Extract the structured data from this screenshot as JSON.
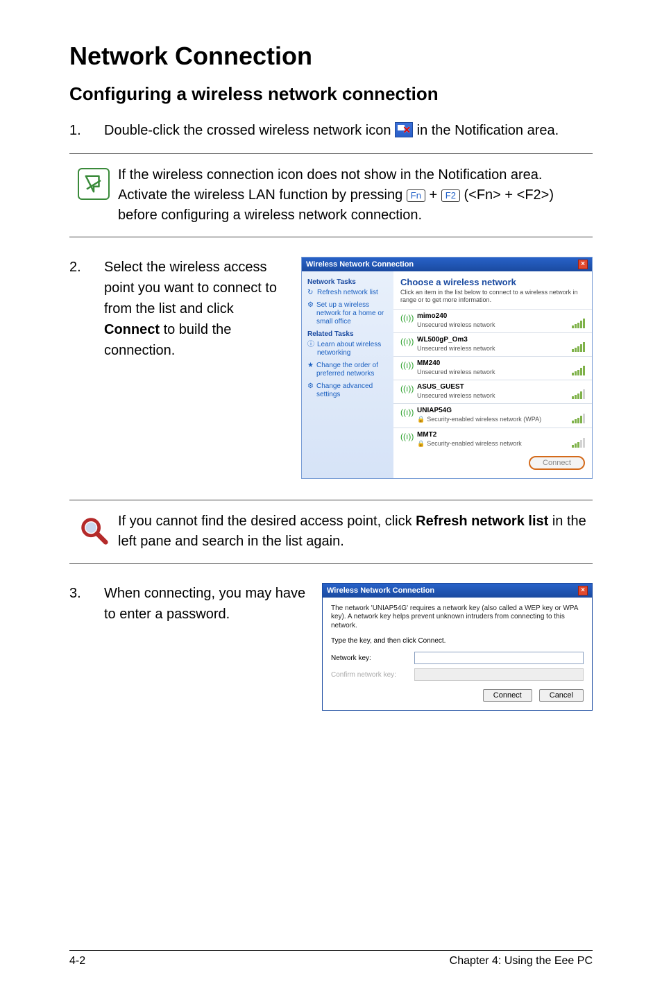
{
  "title": "Network Connection",
  "subtitle": "Configuring a wireless network connection",
  "step1": {
    "num": "1.",
    "text_before": "Double-click the crossed wireless network icon ",
    "text_after": " in the Notification area."
  },
  "note": {
    "text_before": "If the wireless connection icon does not show in the Notification area. Activate the wireless LAN function by pressing ",
    "key1": "Fn",
    "plus": " + ",
    "key2": "F2",
    "text_after": " (<Fn> + <F2>) before configuring a wireless network connection."
  },
  "step2": {
    "num": "2.",
    "text_before": "Select the wireless access point you want to connect to from the list and click ",
    "bold": "Connect",
    "text_after": " to build the connection."
  },
  "wnc": {
    "title": "Wireless Network Connection",
    "main_title": "Choose a wireless network",
    "main_sub": "Click an item in the list below to connect to a wireless network in range or to get more information.",
    "side": {
      "tasks_title": "Network Tasks",
      "refresh": "Refresh network list",
      "setup": "Set up a wireless network for a home or small office",
      "related_title": "Related Tasks",
      "learn": "Learn about wireless networking",
      "order": "Change the order of preferred networks",
      "advanced": "Change advanced settings"
    },
    "networks": [
      {
        "name": "mimo240",
        "desc": "Unsecured wireless network",
        "sig": "s5",
        "secure": false
      },
      {
        "name": "WL500gP_Om3",
        "desc": "Unsecured wireless network",
        "sig": "s5",
        "secure": false
      },
      {
        "name": "MM240",
        "desc": "Unsecured wireless network",
        "sig": "s5",
        "secure": false
      },
      {
        "name": "ASUS_GUEST",
        "desc": "Unsecured wireless network",
        "sig": "s4",
        "secure": false
      },
      {
        "name": "UNIAP54G",
        "desc": "Security-enabled wireless network (WPA)",
        "sig": "s4",
        "secure": true
      },
      {
        "name": "MMT2",
        "desc": "Security-enabled wireless network",
        "sig": "s3",
        "secure": true
      }
    ],
    "connect_btn": "Connect"
  },
  "tip": {
    "text_before": "If you cannot find the desired access point, click ",
    "bold": "Refresh network list",
    "text_after": " in the left pane and search in the list again."
  },
  "step3": {
    "num": "3.",
    "text": "When connecting, you may have to enter a password."
  },
  "pwd": {
    "title": "Wireless Network Connection",
    "msg": "The network 'UNIAP54G' requires a network key (also called a WEP key or WPA key). A network key helps prevent unknown intruders from connecting to this network.",
    "instr": "Type the key, and then click Connect.",
    "key_label": "Network key:",
    "confirm_label": "Confirm network key:",
    "connect": "Connect",
    "cancel": "Cancel"
  },
  "footer": {
    "left": "4-2",
    "right": "Chapter 4: Using the Eee PC"
  }
}
